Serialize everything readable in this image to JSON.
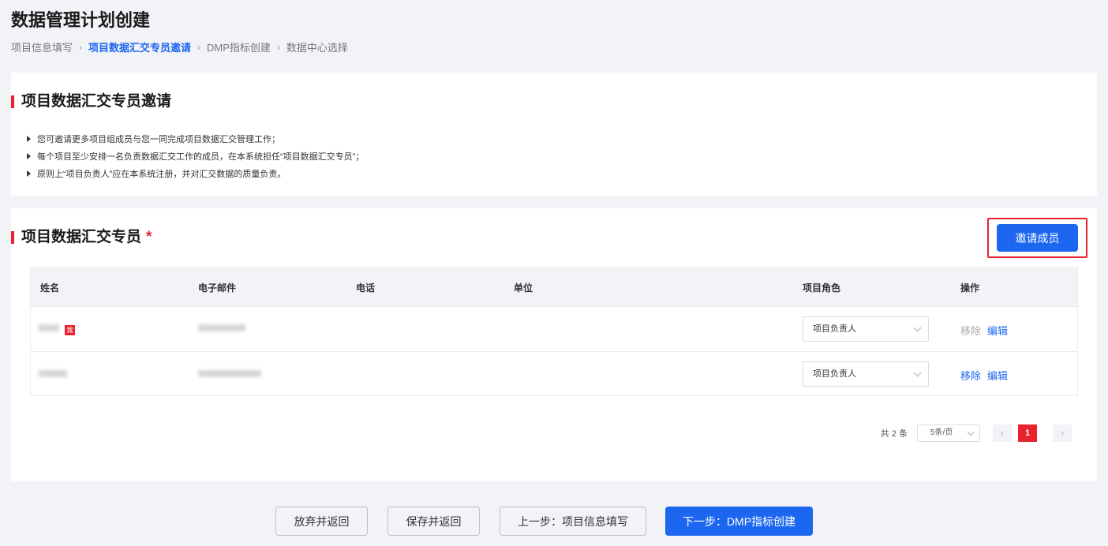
{
  "page": {
    "title": "数据管理计划创建"
  },
  "breadcrumb": {
    "step1": "项目信息填写",
    "step2": "项目数据汇交专员邀请",
    "step3": "DMP指标创建",
    "step4": "数据中心选择"
  },
  "intro": {
    "title": "项目数据汇交专员邀请",
    "notes": [
      "您可邀请更多项目组成员与您一同完成项目数据汇交管理工作；",
      "每个项目至少安排一名负责数据汇交工作的成员，在本系统担任“项目数据汇交专员”；",
      "原则上“项目负责人”应在本系统注册，并对汇交数据的质量负责。"
    ]
  },
  "members": {
    "title": "项目数据汇交专员",
    "required_mark": "*",
    "invite_label": "邀请成员",
    "columns": [
      "姓名",
      "电子邮件",
      "电话",
      "单位",
      "项目角色",
      "操作"
    ],
    "rows": [
      {
        "me_badge": "我",
        "role": "项目负责人",
        "remove": "移除",
        "edit": "编辑",
        "remove_disabled": true
      },
      {
        "role": "项目负责人",
        "remove": "移除",
        "edit": "编辑",
        "remove_disabled": false
      }
    ]
  },
  "pagination": {
    "total": "共 2 条",
    "page_size": "5条/页",
    "current_page": "1",
    "prev_icon": "chevron-left-icon",
    "next_icon": "chevron-right-icon"
  },
  "footer": {
    "discard": "放弃并返回",
    "save": "保存并返回",
    "prev": "上一步：项目信息填写",
    "next": "下一步：DMP指标创建"
  },
  "colors": {
    "primary": "#1d67f0",
    "accent": "#e8232e"
  }
}
